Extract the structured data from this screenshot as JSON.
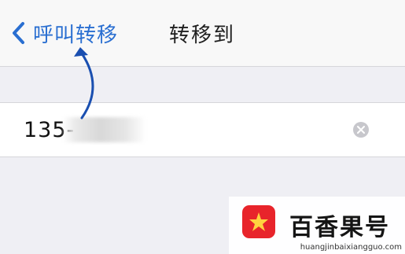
{
  "navbar": {
    "back_label": "呼叫转移",
    "title": "转移到"
  },
  "phone_field": {
    "value": "135- 85"
  },
  "watermark": {
    "brand": "百香果号",
    "url": "huangjinbaixiangguo.com"
  },
  "colors": {
    "accent": "#2a6fd1",
    "background": "#efeff4",
    "cell": "#ffffff",
    "annotation_arrow": "#1a4fb0",
    "logo_red": "#e8242b"
  },
  "icons": [
    "chevron-left-icon",
    "clear-icon",
    "annotation-arrow-icon",
    "brand-logo-icon"
  ]
}
